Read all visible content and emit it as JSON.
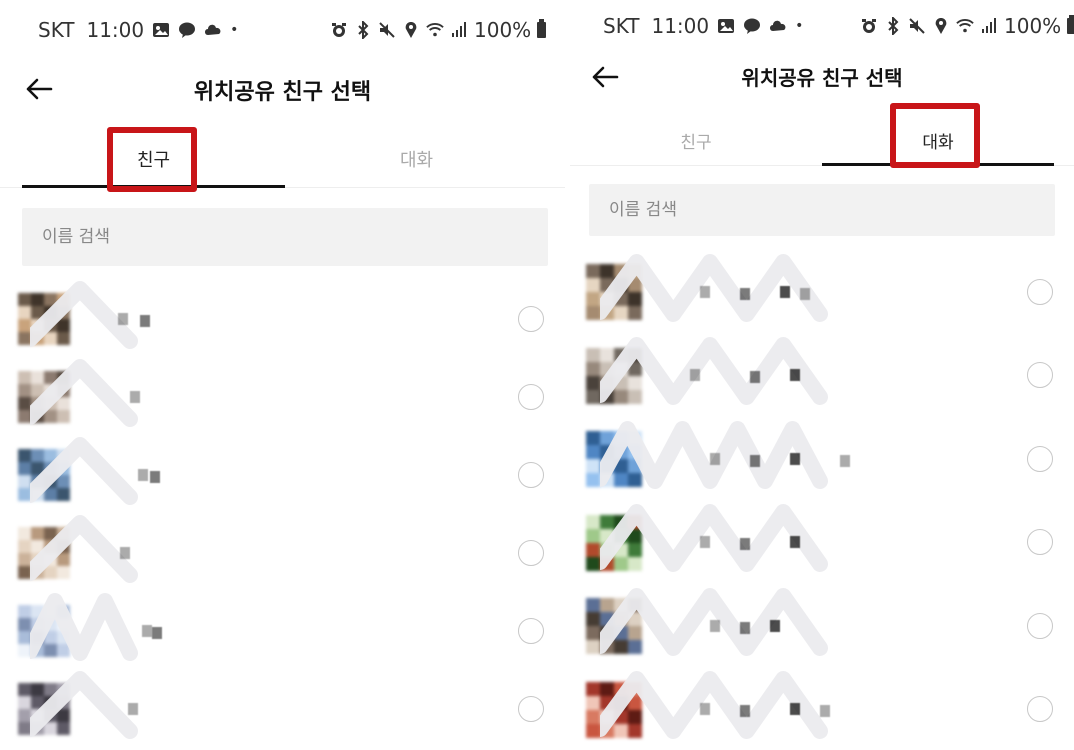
{
  "screens": [
    {
      "status_bar": {
        "carrier": "SKT",
        "time": "11:00",
        "battery": "100%"
      },
      "header": {
        "title": "위치공유 친구 선택"
      },
      "tabs": [
        {
          "label": "친구",
          "active": true
        },
        {
          "label": "대화",
          "active": false
        }
      ],
      "search": {
        "placeholder": "이름 검색"
      },
      "list_count": 6
    },
    {
      "status_bar": {
        "carrier": "SKT",
        "time": "11:00",
        "battery": "100%"
      },
      "header": {
        "title": "위치공유 친구 선택"
      },
      "tabs": [
        {
          "label": "친구",
          "active": false
        },
        {
          "label": "대화",
          "active": true
        }
      ],
      "search": {
        "placeholder": "이름 검색"
      },
      "list_count": 6
    }
  ],
  "colors": {
    "highlight": "#c81518",
    "search_bg": "#f2f2f2",
    "active_tab": "#222222",
    "inactive_tab": "#aaaaaa",
    "radio_border": "#c8c8c8"
  },
  "icons": {
    "back": "arrow-left-icon",
    "gallery": "image-icon",
    "talk": "kakaotalk-icon",
    "alarm": "alarm-icon",
    "bluetooth": "bluetooth-icon",
    "mute": "mute-icon",
    "location": "location-pin-icon",
    "wifi": "wifi-icon",
    "signal": "signal-icon",
    "battery": "battery-icon"
  }
}
